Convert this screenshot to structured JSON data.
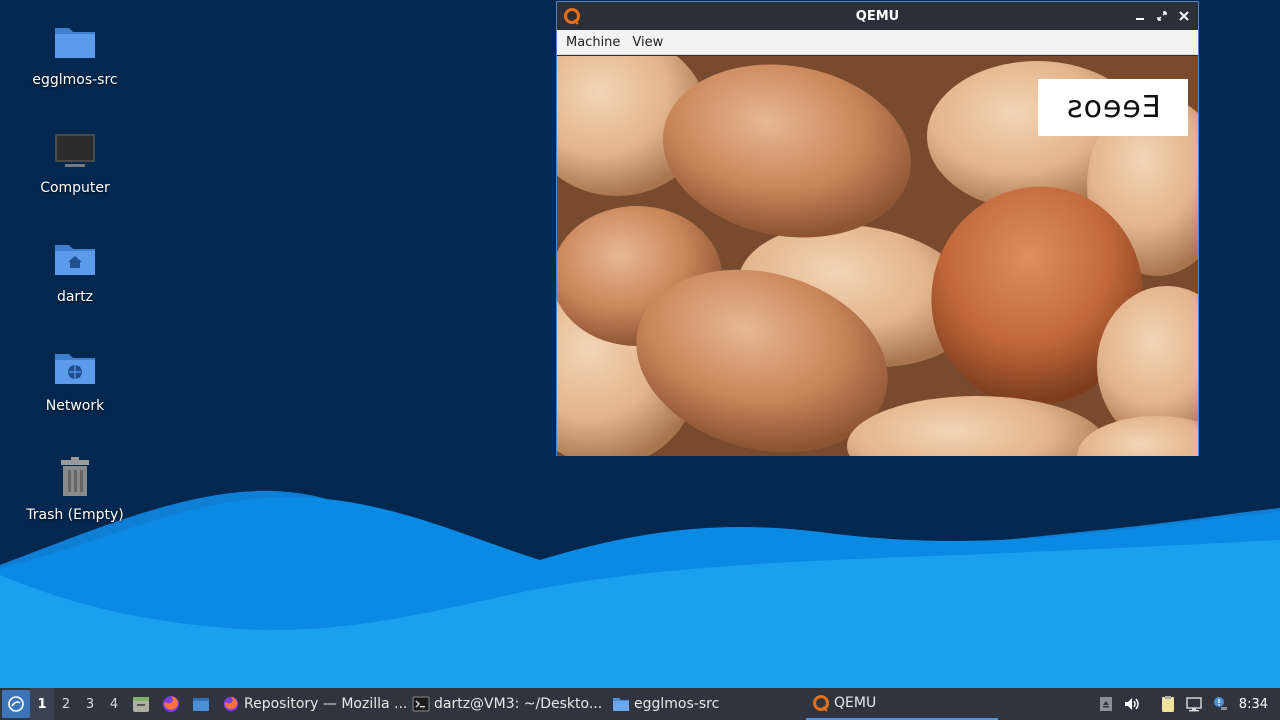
{
  "desktop": {
    "icons": [
      {
        "label": "egglmos-src",
        "icon": "folder-icon"
      },
      {
        "label": "Computer",
        "icon": "computer-icon"
      },
      {
        "label": "dartz",
        "icon": "home-folder-icon"
      },
      {
        "label": "Network",
        "icon": "network-folder-icon"
      },
      {
        "label": "Trash (Empty)",
        "icon": "trash-icon"
      }
    ]
  },
  "qemu_window": {
    "title": "QEMU",
    "menu": [
      "Machine",
      "View"
    ],
    "screen_logo_text": "Eeeos",
    "controls": [
      "minimize-icon",
      "maximize-icon",
      "close-icon"
    ]
  },
  "taskbar": {
    "workspaces": [
      "1",
      "2",
      "3",
      "4"
    ],
    "active_workspace": "1",
    "quick_launch": [
      "file-manager-icon",
      "firefox-icon",
      "files-icon"
    ],
    "tasks": [
      {
        "label": "Repository — Mozilla ...",
        "icon": "firefox-icon"
      },
      {
        "label": "dartz@VM3: ~/Deskto...",
        "icon": "terminal-icon"
      },
      {
        "label": "egglmos-src",
        "icon": "folder-icon"
      },
      {
        "label": "QEMU",
        "icon": "qemu-icon"
      }
    ],
    "tray": [
      "eject-icon",
      "volume-icon",
      "clipboard-icon",
      "network-icon",
      "notification-icon"
    ],
    "clock": "8:34"
  },
  "colors": {
    "desktop_bg": "#03284f",
    "wave_light": "#1aa0ef",
    "wave_mid": "#0a8ae0",
    "taskbar_bg": "#2f343f",
    "accent": "#5294e2"
  }
}
